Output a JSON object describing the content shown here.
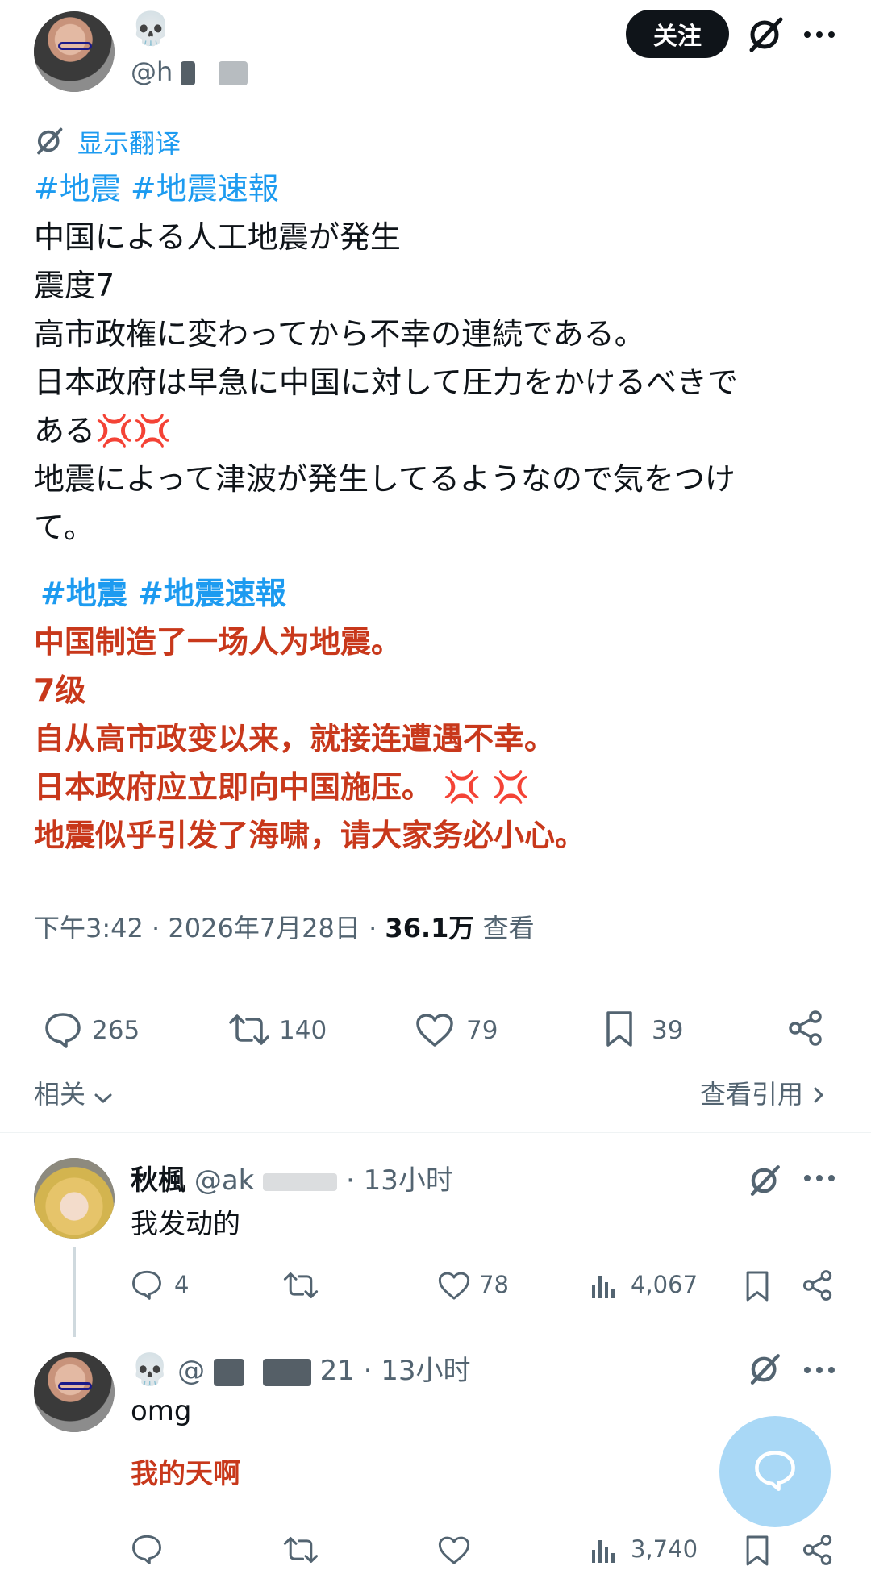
{
  "post": {
    "display_name_emoji": "💀",
    "handle_prefix": "@h",
    "follow_label": "关注",
    "translate_label": "显示翻译",
    "hashtags_ja": "#地震 #地震速報",
    "body_ja": [
      "中国による人工地震が発生",
      "震度7",
      "高市政権に変わってから不幸の連続である。",
      "日本政府は早急に中国に対して圧力をかけるべきで",
      "ある💢💢",
      "地震によって津波が発生してるようなので気をつけ",
      "て。"
    ],
    "hashtags_zh": "#地震 #地震速報",
    "body_zh": [
      "中国制造了一场人为地震。",
      "7级",
      "自从高市政变以来，就接连遭遇不幸。",
      "日本政府应立即向中国施压。 💢 💢",
      "地震似乎引发了海啸，请大家务必小心。"
    ],
    "timestamp": "下午3:42 · 2026年7月28日 ·",
    "views_count": "36.1万",
    "views_label": "查看",
    "stats": {
      "replies": "265",
      "reposts": "140",
      "likes": "79",
      "bookmarks": "39"
    },
    "related_label": "相关",
    "quotes_label": "查看引用"
  },
  "replies": [
    {
      "name": "秋楓",
      "handle": "@ak",
      "time": "· 13小时",
      "text": "我发动的",
      "stats": {
        "replies": "4",
        "likes": "78",
        "views": "4,067"
      }
    },
    {
      "name_emoji": "💀",
      "handle_prefix": "@",
      "handle_suffix": "21 · 13小时",
      "text": "omg",
      "translation": "我的天啊",
      "stats": {
        "views": "3,740"
      }
    }
  ],
  "colors": {
    "accent": "#1d9bf0",
    "translation_red": "#c8381b",
    "muted": "#536471"
  },
  "icons": [
    "grok-icon",
    "more-icon",
    "reply-icon",
    "repost-icon",
    "like-icon",
    "bookmark-icon",
    "share-icon",
    "views-icon",
    "compose-icon"
  ]
}
